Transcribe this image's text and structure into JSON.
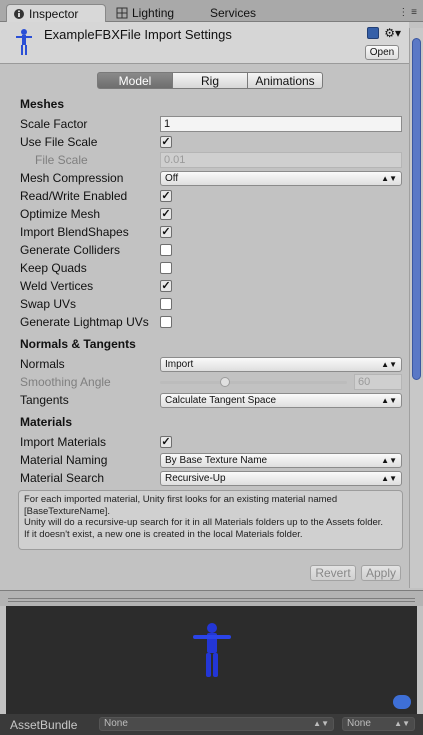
{
  "tabs": {
    "inspector": "Inspector",
    "lighting": "Lighting",
    "services": "Services"
  },
  "header": {
    "title": "ExampleFBXFile Import Settings",
    "open_label": "Open"
  },
  "mode_tabs": [
    "Model",
    "Rig",
    "Animations"
  ],
  "meshes": {
    "title": "Meshes",
    "scale_factor_label": "Scale Factor",
    "scale_factor": "1",
    "use_file_scale_label": "Use File Scale",
    "file_scale_label": "File Scale",
    "file_scale": "0.01",
    "mesh_compression_label": "Mesh Compression",
    "mesh_compression": "Off",
    "read_write_label": "Read/Write Enabled",
    "optimize_label": "Optimize Mesh",
    "blendshapes_label": "Import BlendShapes",
    "colliders_label": "Generate Colliders",
    "quads_label": "Keep Quads",
    "weld_label": "Weld Vertices",
    "swap_label": "Swap UVs",
    "lightmap_label": "Generate Lightmap UVs"
  },
  "normals": {
    "title": "Normals & Tangents",
    "normals_label": "Normals",
    "normals_value": "Import",
    "smoothing_label": "Smoothing Angle",
    "smoothing_value": "60",
    "tangents_label": "Tangents",
    "tangents_value": "Calculate Tangent Space"
  },
  "materials": {
    "title": "Materials",
    "import_label": "Import Materials",
    "naming_label": "Material Naming",
    "naming_value": "By Base Texture Name",
    "search_label": "Material Search",
    "search_value": "Recursive-Up",
    "help_1": "For each imported material, Unity first looks for an existing material named [BaseTextureName].",
    "help_2": "Unity will do a recursive-up search for it in all Materials folders up to the Assets folder.",
    "help_3": "If it doesn't exist, a new one is created in the local Materials folder."
  },
  "buttons": {
    "revert": "Revert",
    "apply": "Apply"
  },
  "assetbundle": {
    "label": "AssetBundle",
    "bundle": "None",
    "variant": "None"
  }
}
